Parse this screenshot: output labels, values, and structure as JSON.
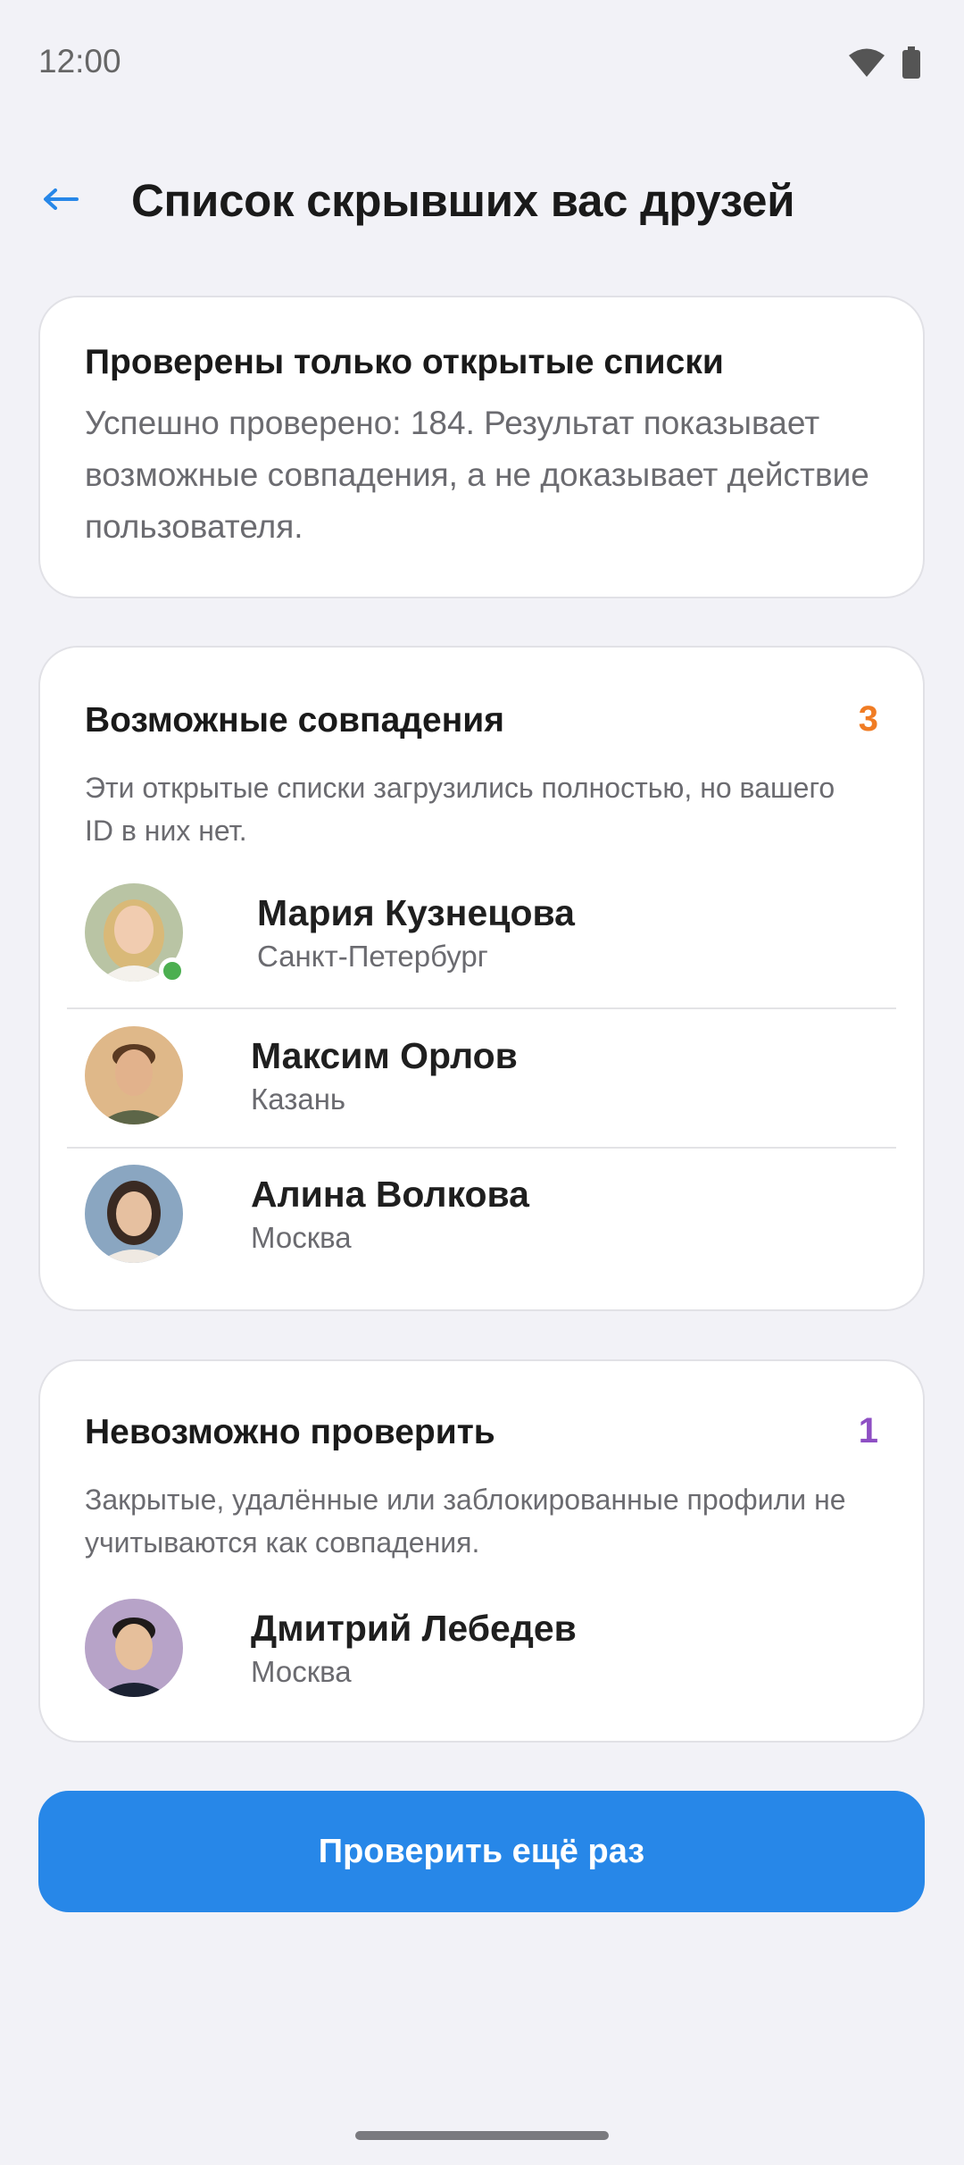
{
  "status_bar": {
    "time": "12:00",
    "icons": [
      "wifi-icon",
      "battery-icon"
    ]
  },
  "header": {
    "back_icon": "arrow-left-icon",
    "title": "Список скрывших вас друзей"
  },
  "info_card": {
    "heading": "Проверены только открытые списки",
    "body": "Успешно проверено: 184. Результат показывает возможные совпадения, а не доказывает действие пользователя."
  },
  "matches_card": {
    "heading": "Возможные совпадения",
    "count": "3",
    "subtitle": "Эти открытые списки загрузились полностью, но вашего ID в них нет.",
    "people": [
      {
        "name": "Мария Кузнецова",
        "city": "Санкт-Петербург",
        "online": true
      },
      {
        "name": "Максим Орлов",
        "city": "Казань",
        "online": false
      },
      {
        "name": "Алина Волкова",
        "city": "Москва",
        "online": false
      }
    ]
  },
  "unverifiable_card": {
    "heading": "Невозможно проверить",
    "count": "1",
    "subtitle": "Закрытые, удалённые или заблокированные профили не учитываются как совпадения.",
    "people": [
      {
        "name": "Дмитрий Лебедев",
        "city": "Москва"
      }
    ]
  },
  "primary_action": {
    "label": "Проверить ещё раз"
  },
  "colors": {
    "accent": "#2787e8",
    "matches_count": "#f07c24",
    "unverifiable_count": "#8e4fc4",
    "online": "#4caf50"
  }
}
